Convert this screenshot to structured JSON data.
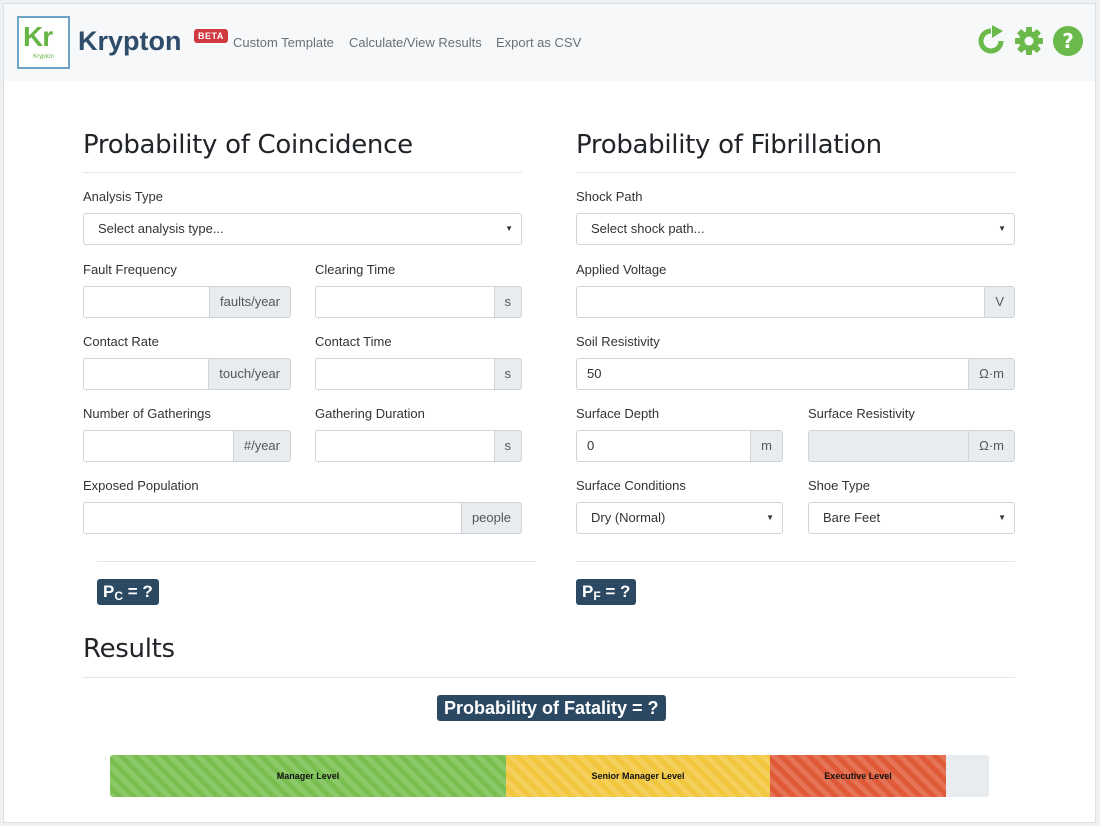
{
  "app": {
    "logo_text": "Kr",
    "logo_subtext": "Krypton",
    "brand": "Krypton",
    "beta_badge": "BETA"
  },
  "nav": {
    "links": [
      "Custom Template",
      "Calculate/View Results",
      "Export as CSV"
    ],
    "icons": [
      "refresh-icon",
      "gear-icon",
      "help-icon"
    ],
    "icon_color": "#6ab94a"
  },
  "coincidence": {
    "title": "Probability of Coincidence",
    "analysis_type": {
      "label": "Analysis Type",
      "value": "Select analysis type..."
    },
    "fault_frequency": {
      "label": "Fault Frequency",
      "value": "",
      "unit": "faults/year"
    },
    "clearing_time": {
      "label": "Clearing Time",
      "value": "",
      "unit": "s"
    },
    "contact_rate": {
      "label": "Contact Rate",
      "value": "",
      "unit": "touch/year"
    },
    "contact_time": {
      "label": "Contact Time",
      "value": "",
      "unit": "s"
    },
    "number_of_gatherings": {
      "label": "Number of Gatherings",
      "value": "",
      "unit": "#/year"
    },
    "gathering_duration": {
      "label": "Gathering Duration",
      "value": "",
      "unit": "s"
    },
    "exposed_population": {
      "label": "Exposed Population",
      "value": "",
      "unit": "people"
    },
    "result": {
      "prefix": "P",
      "sub": "C",
      "suffix": " = ?"
    }
  },
  "fibrillation": {
    "title": "Probability of Fibrillation",
    "shock_path": {
      "label": "Shock Path",
      "value": "Select shock path..."
    },
    "applied_voltage": {
      "label": "Applied Voltage",
      "value": "",
      "unit": "V"
    },
    "soil_resistivity": {
      "label": "Soil Resistivity",
      "value": "50",
      "unit": "Ω·m"
    },
    "surface_depth": {
      "label": "Surface Depth",
      "value": "0",
      "unit": "m"
    },
    "surface_resistivity": {
      "label": "Surface Resistivity",
      "value": "",
      "unit": "Ω·m"
    },
    "surface_conditions": {
      "label": "Surface Conditions",
      "value": "Dry (Normal)"
    },
    "shoe_type": {
      "label": "Shoe Type",
      "value": "Bare Feet"
    },
    "result": {
      "prefix": "P",
      "sub": "F",
      "suffix": " = ?"
    }
  },
  "results": {
    "title": "Results",
    "fatality_badge": "Probability of Fatality = ?",
    "risk_levels": [
      {
        "label": "Manager Level",
        "share": 0.45,
        "color": "#78bf4f"
      },
      {
        "label": "Senior Manager Level",
        "share": 0.3,
        "color": "#f2c73e"
      },
      {
        "label": "Executive Level",
        "share": 0.2,
        "color": "#e05a38"
      }
    ]
  }
}
